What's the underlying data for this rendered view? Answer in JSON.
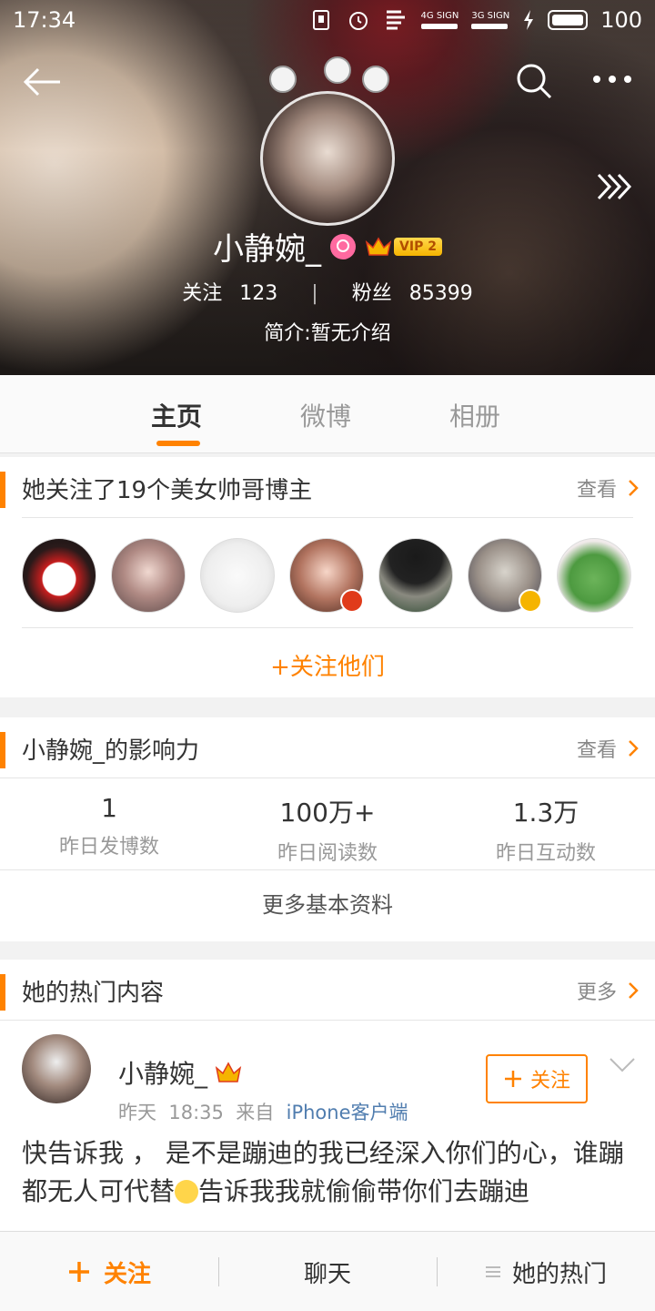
{
  "status_bar": {
    "time": "17:34",
    "network_1": "4G SIGN",
    "network_2": "3G SIGN",
    "battery": "100"
  },
  "profile": {
    "name": "小静婉_",
    "vip": "VIP 2",
    "following_label": "关注",
    "following_count": "123",
    "fans_label": "粉丝",
    "fans_count": "85399",
    "bio": "简介:暂无介绍"
  },
  "tabs": [
    {
      "label": "主页",
      "active": true
    },
    {
      "label": "微博",
      "active": false
    },
    {
      "label": "相册",
      "active": false
    }
  ],
  "following_card": {
    "title": "她关注了19个美女帅哥博主",
    "link": "查看",
    "follow_all": "+关注他们",
    "avatars": [
      {
        "name": "avatar-1",
        "verified": false
      },
      {
        "name": "avatar-2",
        "verified": false
      },
      {
        "name": "avatar-3",
        "verified": false
      },
      {
        "name": "avatar-4",
        "verified": true,
        "badge_color": "#e03b1a"
      },
      {
        "name": "avatar-5",
        "verified": false
      },
      {
        "name": "avatar-6",
        "verified": true,
        "badge_color": "#f5b400"
      },
      {
        "name": "avatar-7",
        "verified": false
      }
    ]
  },
  "influence_card": {
    "title": "小静婉_的影响力",
    "link": "查看",
    "metrics": [
      {
        "value": "1",
        "label": "昨日发博数"
      },
      {
        "value": "100万+",
        "label": "昨日阅读数"
      },
      {
        "value": "1.3万",
        "label": "昨日互动数"
      }
    ],
    "more": "更多基本资料"
  },
  "hot_card": {
    "title": "她的热门内容",
    "link": "更多",
    "post": {
      "author": "小静婉_",
      "time_label": "昨天",
      "time": "18:35",
      "from_label": "来自",
      "source": "iPhone客户端",
      "follow_label": "关注",
      "text_before": "快告诉我 ， 是不是蹦迪的我已经深入你们的心，谁蹦都无人可代替",
      "text_after": "告诉我我就偷偷带你们去蹦迪"
    }
  },
  "bottom_bar": {
    "follow": "关注",
    "chat": "聊天",
    "hot": "她的热门"
  },
  "colors": {
    "accent": "#ff8200",
    "link_blue": "#507daf"
  }
}
